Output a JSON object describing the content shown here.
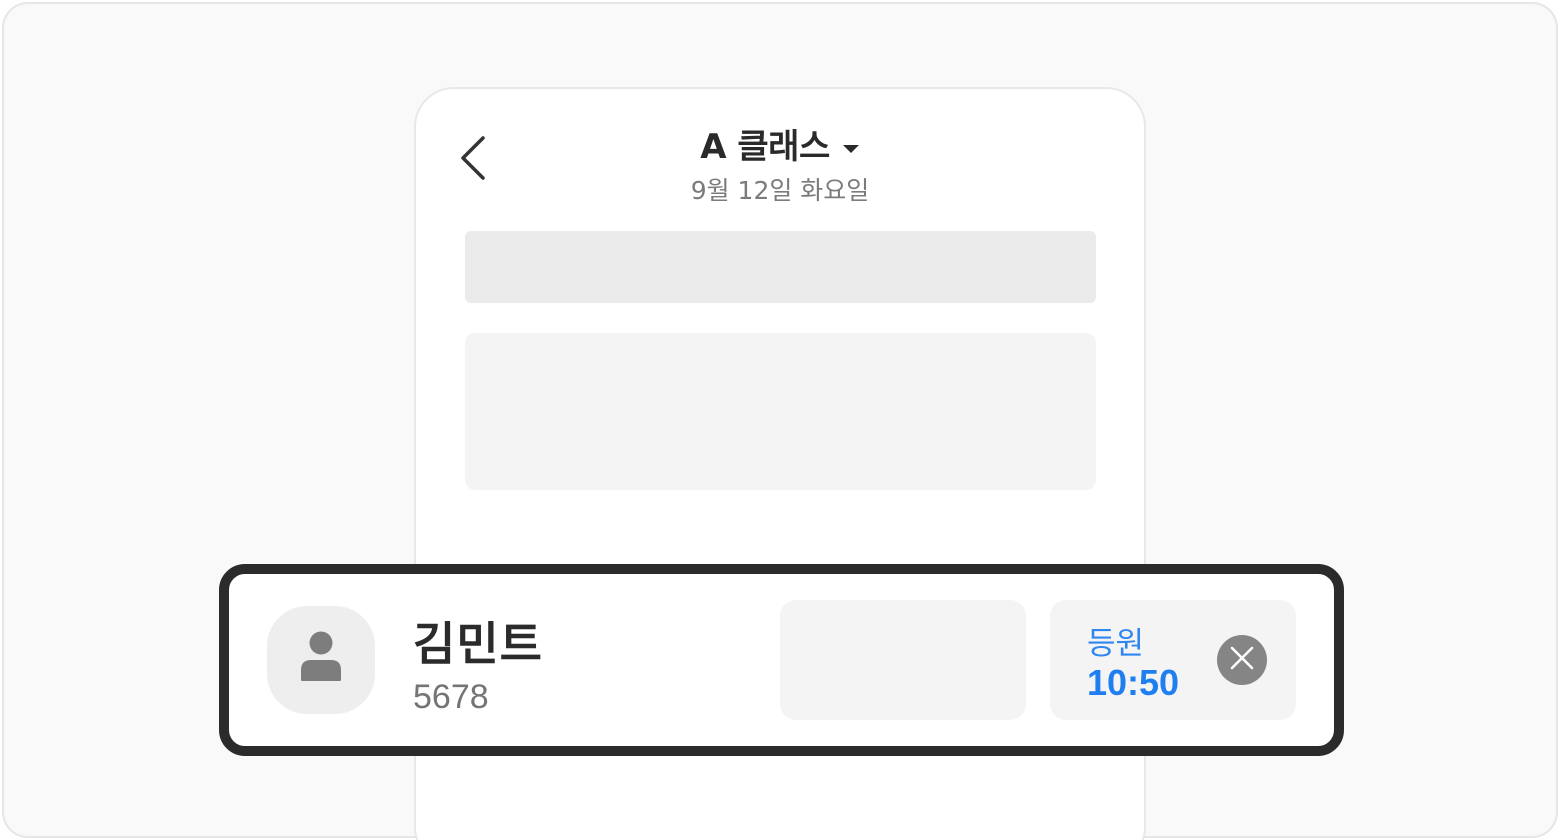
{
  "header": {
    "back_icon": "chevron-left-icon",
    "class_name": "A 클래스",
    "class_dropdown_icon": "caret-down-icon",
    "date": "9월 12일 화요일"
  },
  "student": {
    "avatar_icon": "person-icon",
    "name": "김민트",
    "id": "5678",
    "status_label": "등원",
    "status_time": "10:50",
    "remove_icon": "close-icon"
  },
  "colors": {
    "accent": "#1f7ff0",
    "text_primary": "#2b2b2b",
    "text_secondary": "#7b7b7b",
    "card_border": "#2b2b2b"
  }
}
